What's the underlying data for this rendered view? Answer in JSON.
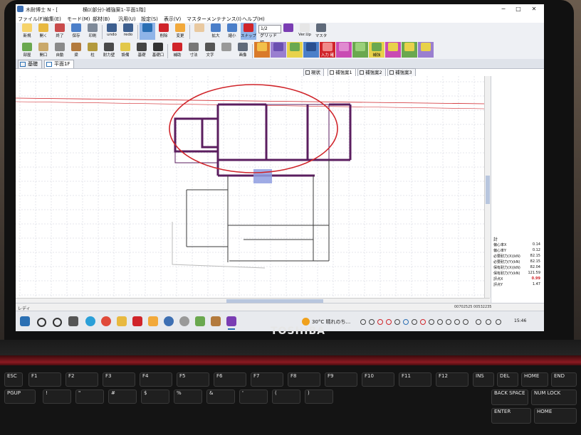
{
  "window": {
    "app_name": "木耐博士 N - [",
    "document_title": "横ﾛ(部分)-補強案1-平面1階]",
    "minimize": "─",
    "maximize": "□",
    "close": "✕"
  },
  "menubar": {
    "items": [
      "ファイル(F)",
      "編集(E)",
      "モード(M)",
      "部材(B)",
      "汎用(U)",
      "設定(S)",
      "表示(V)",
      "マスターメンテナンス(I)",
      "ヘルプ(H)"
    ]
  },
  "toolbar1": {
    "buttons": [
      "新規",
      "開く",
      "終了",
      "保存",
      "印刷",
      "undo",
      "redo",
      "",
      "削除",
      "変更",
      "",
      "拡大",
      "縮小",
      "",
      "",
      "Ver.Up",
      "マスタ"
    ],
    "snap_label": "スナップ",
    "grid_value": "1/2",
    "grid_label": "グリッド幅"
  },
  "toolbar2": {
    "buttons": [
      "部屋",
      "開口",
      "自動",
      "梁",
      "柱",
      "耐力壁",
      "設備",
      "基礎",
      "基礎口",
      "補助",
      "寸法",
      "文字",
      "",
      "画像"
    ],
    "color_buttons": [
      "",
      "",
      "",
      "",
      "入力 確認",
      "",
      "",
      "補強",
      "",
      "",
      ""
    ]
  },
  "layer_tabs": [
    "基礎",
    "平面1F"
  ],
  "plan_tabs": [
    "現状",
    "補強案1",
    "補強案2",
    "補強案3"
  ],
  "results": {
    "title": "計",
    "rows": [
      {
        "label": "偏心率X",
        "value": "0.14"
      },
      {
        "label": "偏心率Y",
        "value": "0.12"
      },
      {
        "label": "必要耐力(X)(kN)",
        "value": "82.15"
      },
      {
        "label": "必要耐力(Y)(kN)",
        "value": "82.15"
      },
      {
        "label": "保有耐力(X)(kN)",
        "value": "82.04"
      },
      {
        "label": "保有耐力(Y)(kN)",
        "value": "121.59"
      },
      {
        "label": "評点X",
        "value": "0.99"
      },
      {
        "label": "評点Y",
        "value": "1.47"
      }
    ]
  },
  "statusbar": {
    "text": "レディ",
    "coords": "00702525   00532235"
  },
  "taskbar": {
    "weather": "30°C  晴れのち...",
    "clock": "15:46"
  },
  "laptop": {
    "brand": "TOSHIBA",
    "keys": [
      "ESC",
      "F1",
      "F2",
      "F3",
      "F4",
      "F5",
      "F6",
      "F7",
      "F8",
      "F9",
      "F10",
      "F11",
      "F12",
      "INS",
      "DEL",
      "HOME",
      "END",
      "PGUP",
      "!",
      "\"",
      "#",
      "$",
      "%",
      "&",
      "'",
      "(",
      ")",
      "BACK SPACE",
      "NUM LOCK",
      "ENTER",
      "HOME"
    ]
  },
  "colors": {
    "accent": "#2a6fb3",
    "wall": "#5b1e5f",
    "highlight": "#d0242a",
    "selection": "#8f9de0"
  }
}
